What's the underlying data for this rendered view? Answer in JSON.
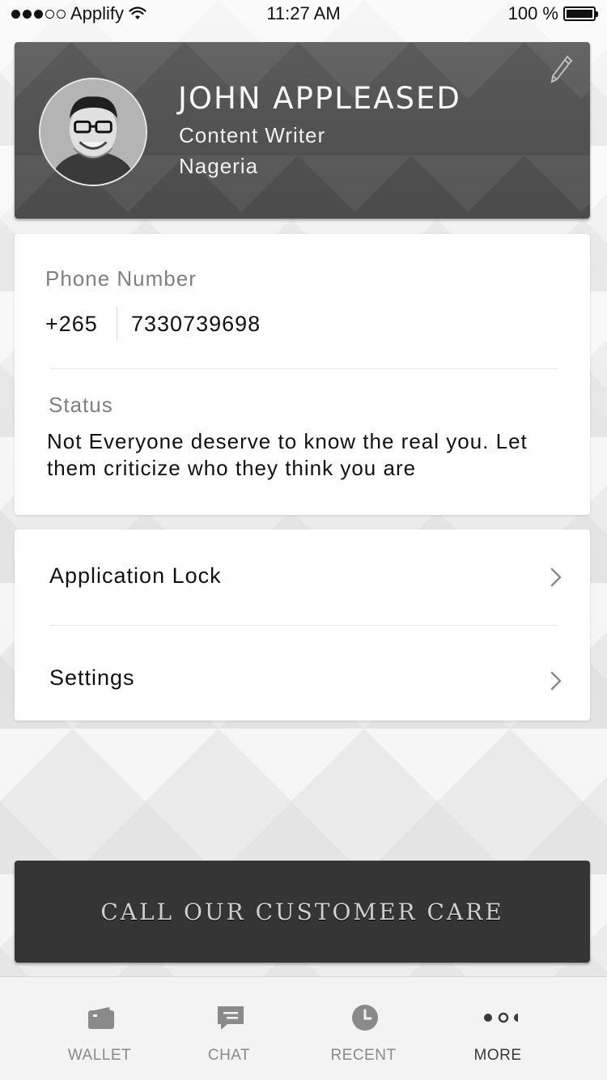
{
  "status_bar": {
    "carrier": "Applify",
    "time": "11:27 AM",
    "battery_percent": "100 %",
    "signal_bars_filled": 3,
    "signal_bars_total": 5,
    "battery_level": 1.0
  },
  "profile": {
    "name": "JOHN APPLEASED",
    "title": "Content Writer",
    "location": "Nageria",
    "avatar_icon": "user-avatar",
    "edit_icon": "pencil-icon"
  },
  "contact": {
    "phone_label": "Phone Number",
    "country_code": "+265",
    "phone_number": "7330739698",
    "status_label": "Status",
    "status_text": "Not Everyone deserve to know the real you. Let them criticize who they think you are"
  },
  "menu": {
    "items": [
      {
        "label": "Application Lock",
        "icon": "chevron-right-icon"
      },
      {
        "label": "Settings",
        "icon": "chevron-right-icon"
      }
    ]
  },
  "cta": {
    "label": "CALL OUR CUSTOMER CARE"
  },
  "tab_bar": {
    "tabs": [
      {
        "label": "WALLET",
        "icon": "wallet-icon",
        "active": false
      },
      {
        "label": "CHAT",
        "icon": "chat-icon",
        "active": false
      },
      {
        "label": "RECENT",
        "icon": "clock-icon",
        "active": false
      },
      {
        "label": "MORE",
        "icon": "more-icon",
        "active": true
      }
    ]
  },
  "colors": {
    "card_dark": "#4b4b4b",
    "cta_dark": "#353535",
    "accent_text": "#111111",
    "muted_text": "#808080"
  }
}
